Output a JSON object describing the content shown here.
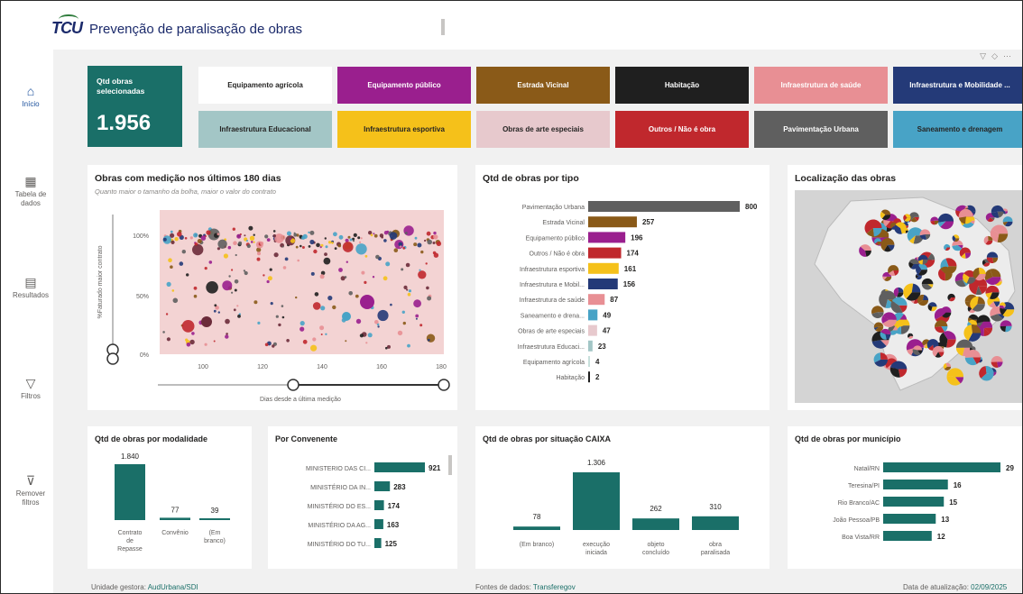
{
  "app": {
    "logo": "TCU",
    "title": "Prevenção de paralisação de obras"
  },
  "nav": [
    {
      "label": "Início",
      "icon": "home-icon",
      "glyph": "⌂"
    },
    {
      "label": "Tabela de dados",
      "icon": "table-icon",
      "glyph": "▦"
    },
    {
      "label": "Resultados",
      "icon": "results-icon",
      "glyph": "▤"
    },
    {
      "label": "Filtros",
      "icon": "filter-icon",
      "glyph": "▽"
    },
    {
      "label": "Remover filtros",
      "icon": "clear-filter-icon",
      "glyph": "⊽"
    }
  ],
  "kpi": {
    "label": "Qtd obras selecionadas",
    "value": "1.956"
  },
  "tiles": [
    {
      "label": "Equipamento agrícola",
      "bg": "#ffffff",
      "fg": "#252423"
    },
    {
      "label": "Equipamento público",
      "bg": "#9a1f8e",
      "fg": "#ffffff"
    },
    {
      "label": "Estrada Vicinal",
      "bg": "#8a5a18",
      "fg": "#ffffff"
    },
    {
      "label": "Habitação",
      "bg": "#1f1f1f",
      "fg": "#ffffff"
    },
    {
      "label": "Infraestrutura de saúde",
      "bg": "#e88f94",
      "fg": "#ffffff"
    },
    {
      "label": "Infraestrutura e Mobilidade ...",
      "bg": "#243a78",
      "fg": "#ffffff"
    },
    {
      "label": "Infraestrutura Educacional",
      "bg": "#a3c6c6",
      "fg": "#252423"
    },
    {
      "label": "Infraestrutura esportiva",
      "bg": "#f5c11a",
      "fg": "#252423"
    },
    {
      "label": "Obras de arte especiais",
      "bg": "#e7c9cd",
      "fg": "#252423"
    },
    {
      "label": "Outros / Não é obra",
      "bg": "#c0282d",
      "fg": "#ffffff"
    },
    {
      "label": "Pavimentação Urbana",
      "bg": "#5f5f5f",
      "fg": "#ffffff"
    },
    {
      "label": "Saneamento e drenagem",
      "bg": "#48a3c6",
      "fg": "#252423"
    }
  ],
  "scatter": {
    "title": "Obras com medição nos últimos 180 dias",
    "subtitle": "Quanto maior o tamanho da bolha, maior o valor do contrato",
    "ylabel": "%Faturado maior contrato",
    "xlabel": "Dias desde a última medição",
    "xticks": [
      "100",
      "120",
      "140",
      "160",
      "180"
    ],
    "yticks": [
      "100%",
      "50%",
      "0%"
    ]
  },
  "colors": {
    "teal": "#1a6f68",
    "bar_gray": "#5f5f5f",
    "plot_bg": "#f3d3d3"
  },
  "chart_data": [
    {
      "type": "bar",
      "title": "Qtd de obras por tipo",
      "categories": [
        "Pavimentação Urbana",
        "Estrada Vicinal",
        "Equipamento público",
        "Outros / Não é obra",
        "Infraestrutura esportiva",
        "Infraestrutura e Mobil...",
        "Infraestrutura de saúde",
        "Saneamento e drena...",
        "Obras de arte especiais",
        "Infraestrutura Educaci...",
        "Equipamento agrícola",
        "Habitação"
      ],
      "values": [
        800,
        257,
        196,
        174,
        161,
        156,
        87,
        49,
        47,
        23,
        4,
        2
      ],
      "colors": [
        "#5f5f5f",
        "#8a5a18",
        "#9a1f8e",
        "#c0282d",
        "#f5c11a",
        "#243a78",
        "#e88f94",
        "#48a3c6",
        "#e7c9cd",
        "#a3c6c6",
        "#c8e0dc",
        "#1f1f1f"
      ]
    },
    {
      "type": "bar",
      "title": "Qtd de obras por modalidade",
      "categories": [
        "Contrato de Repasse",
        "Convênio",
        "(Em branco)"
      ],
      "values": [
        1840,
        77,
        39
      ],
      "value_labels": [
        "1.840",
        "77",
        "39"
      ]
    },
    {
      "type": "bar",
      "title": "Por Convenente",
      "categories": [
        "MINISTERIO DAS CI...",
        "MINISTÉRIO DA IN...",
        "MINISTÉRIO DO ES...",
        "MINISTÉRIO DA AG...",
        "MINISTÉRIO DO TU..."
      ],
      "values": [
        921,
        283,
        174,
        163,
        125
      ]
    },
    {
      "type": "bar",
      "title": "Qtd de obras por situação CAIXA",
      "categories": [
        "(Em branco)",
        "execução iniciada",
        "objeto concluído",
        "obra paralisada"
      ],
      "values": [
        78,
        1306,
        262,
        310
      ],
      "value_labels": [
        "78",
        "1.306",
        "262",
        "310"
      ]
    },
    {
      "type": "bar",
      "title": "Qtd de obras por município",
      "categories": [
        "Natal/RN",
        "Teresina/PI",
        "Rio Branco/AC",
        "João Pessoa/PB",
        "Boa Vista/RR"
      ],
      "values": [
        29,
        16,
        15,
        13,
        12
      ]
    }
  ],
  "map": {
    "title": "Localização das obras"
  },
  "footer": {
    "unit_label": "Unidade gestora:",
    "unit_value": "AudUrbana/SDI",
    "source_label": "Fontes de dados:",
    "source_value": "Transferegov",
    "date_label": "Data de atualização:",
    "date_value": "02/09/2025"
  }
}
